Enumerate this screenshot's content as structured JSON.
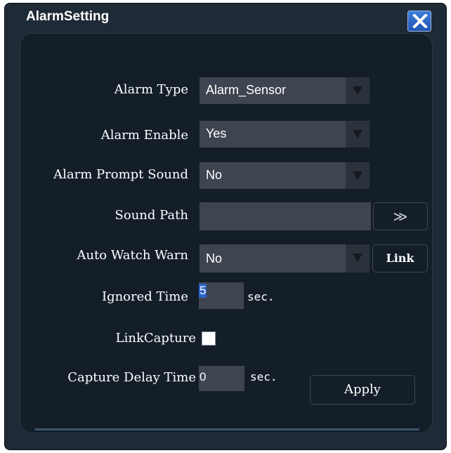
{
  "window": {
    "title": "AlarmSetting"
  },
  "form": {
    "alarm_type": {
      "label": "Alarm Type",
      "value": "Alarm_Sensor"
    },
    "alarm_enable": {
      "label": "Alarm Enable",
      "value": "Yes"
    },
    "alarm_prompt_sound": {
      "label": "Alarm Prompt Sound",
      "value": "No"
    },
    "sound_path": {
      "label": "Sound Path",
      "value": "",
      "browse_label": "≫"
    },
    "auto_watch_warn": {
      "label": "Auto Watch Warn",
      "value": "No",
      "link_label": "Link"
    },
    "ignored_time": {
      "label": "Ignored Time",
      "value": "5",
      "unit": "sec."
    },
    "link_capture": {
      "label": "LinkCapture",
      "checked": false
    },
    "capture_delay_time": {
      "label": "Capture Delay Time",
      "value": "0",
      "unit": "sec."
    }
  },
  "apply_label": "Apply",
  "colors": {
    "window_bg": "#1e2b36",
    "panel_bg": "#141e29",
    "field_bg": "#3e4550",
    "close_button": "#2e6ac8",
    "selection": "#2b63c9"
  }
}
